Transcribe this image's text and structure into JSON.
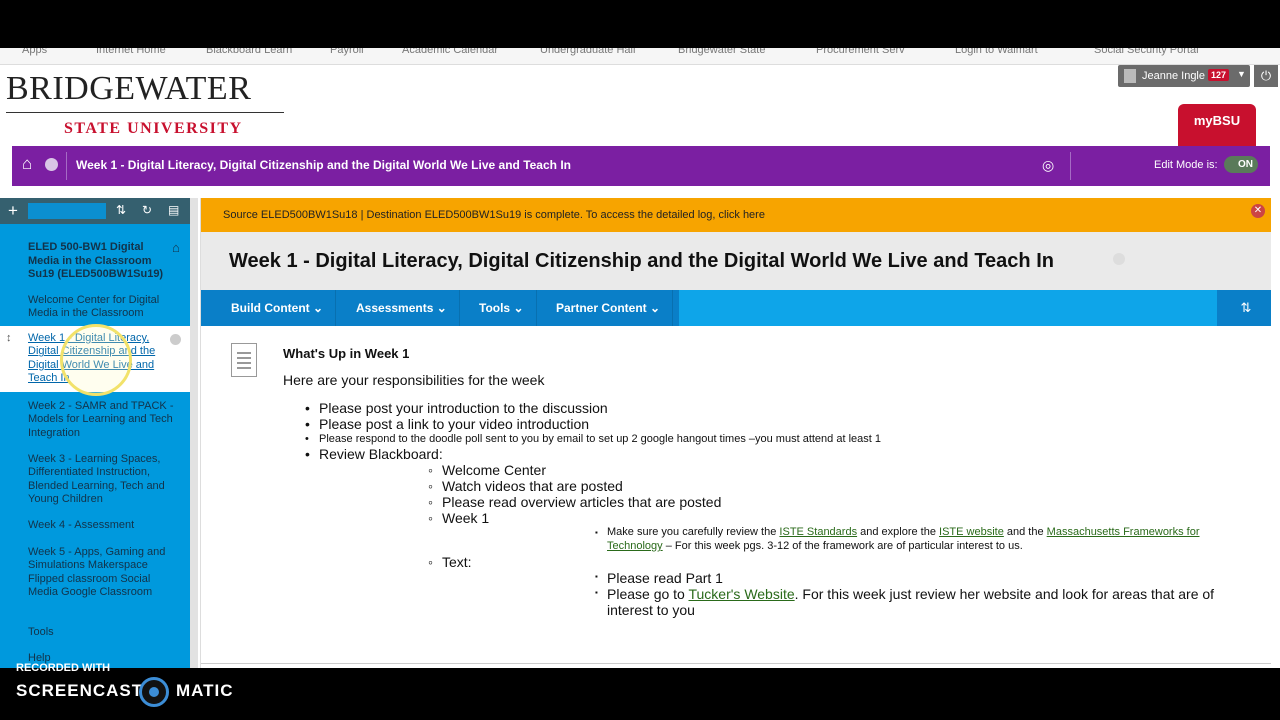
{
  "bookmarks": [
    "Apps",
    "Internet Home",
    "Blackboard Learn",
    "Payroll",
    "Academic Calendar",
    "Undergraduate Hall",
    "Bridgewater State",
    "Procurement Serv",
    "Login to Walmart",
    "Social Security Portal"
  ],
  "brand": {
    "name": "BRIDGEWATER",
    "sub": "STATE UNIVERSITY"
  },
  "user": {
    "name": "Jeanne Ingle",
    "notifications": "127"
  },
  "mybsu": "myBSU",
  "breadcrumb": {
    "title": "Week 1 - Digital Literacy, Digital Citizenship and the Digital World We Live and Teach In"
  },
  "edit_mode": {
    "label": "Edit Mode is:",
    "state": "ON"
  },
  "sidebar": {
    "course": "ELED 500-BW1 Digital Media in the Classroom Su19 (ELED500BW1Su19)",
    "items": [
      {
        "label": "Welcome Center for Digital Media in the Classroom"
      },
      {
        "label": "Week 1 - Digital Literacy, Digital Citizenship and the Digital World We Live and Teach In"
      },
      {
        "label": "Week 2 - SAMR and TPACK - Models for Learning and Tech Integration"
      },
      {
        "label": "Week 3 - Learning Spaces, Differentiated Instruction, Blended Learning, Tech and Young Children"
      },
      {
        "label": "Week 4 - Assessment"
      },
      {
        "label": "Week 5 - Apps, Gaming and Simulations Makerspace Flipped classroom Social Media Google Classroom"
      },
      {
        "label": "Tools"
      },
      {
        "label": "Help"
      }
    ]
  },
  "notice": "Source ELED500BW1Su18 | Destination ELED500BW1Su19 is complete. To access the detailed log, click here",
  "content": {
    "title": "Week 1 - Digital Literacy, Digital Citizenship and the Digital World We Live and Teach In",
    "action_buttons": [
      "Build Content",
      "Assessments",
      "Tools",
      "Partner Content"
    ],
    "item": {
      "title": "What's Up in Week 1",
      "intro": "Here are your responsibilities for the week",
      "bullets": [
        "Please post your introduction to the discussion",
        "Please post a link to your video introduction",
        "Please respond to the doodle poll sent to you by email to set up 2 google hangout times –you must attend at least 1",
        "Review Blackboard:"
      ],
      "sub_bullets": [
        "Welcome Center",
        "Watch videos that are posted",
        "Please read overview articles that are posted",
        "Week 1"
      ],
      "week1_detail": {
        "pre": "Make sure you carefully review the ",
        "link1": "ISTE Standards",
        "mid1": " and explore the ",
        "link2": "ISTE website",
        "mid2": " and the ",
        "link3": "Massachusetts Frameworks for",
        "link3b": "Technology",
        "post": " – For this week pgs. 3-12 of the framework are of particular interest to us."
      },
      "text_label": "Text:",
      "text_items": [
        "Please read Part 1",
        {
          "pre": "Please go to ",
          "link": "Tucker's Website",
          "post": ". For this week just review her website and look for areas that are of",
          "post2": "interest to you"
        }
      ]
    }
  },
  "recording": {
    "label": "RECORDED WITH",
    "brand_left": "SCREENCAST",
    "brand_right": "MATIC"
  }
}
